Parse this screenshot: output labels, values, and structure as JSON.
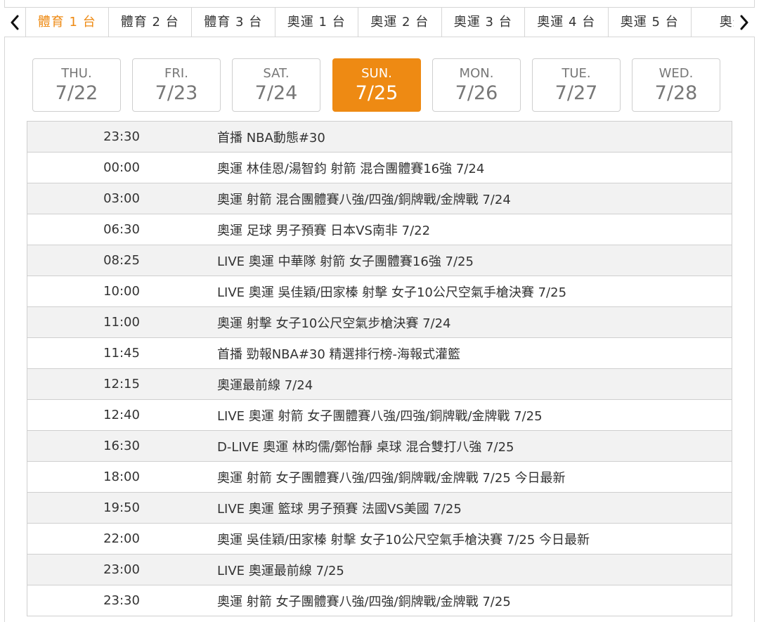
{
  "tabbar": {
    "prev_label": "<",
    "next_label": ">",
    "tabs": [
      {
        "label": "體育 1 台",
        "active": true
      },
      {
        "label": "體育 2 台",
        "active": false
      },
      {
        "label": "體育 3 台",
        "active": false
      },
      {
        "label": "奧運 1 台",
        "active": false
      },
      {
        "label": "奧運 2 台",
        "active": false
      },
      {
        "label": "奧運 3 台",
        "active": false
      },
      {
        "label": "奧運 4 台",
        "active": false
      },
      {
        "label": "奧運 5 台",
        "active": false
      },
      {
        "label": "奧運",
        "active": false
      }
    ]
  },
  "dates": [
    {
      "dow": "THU.",
      "md": "7/22",
      "active": false
    },
    {
      "dow": "FRI.",
      "md": "7/23",
      "active": false
    },
    {
      "dow": "SAT.",
      "md": "7/24",
      "active": false
    },
    {
      "dow": "SUN.",
      "md": "7/25",
      "active": true
    },
    {
      "dow": "MON.",
      "md": "7/26",
      "active": false
    },
    {
      "dow": "TUE.",
      "md": "7/27",
      "active": false
    },
    {
      "dow": "WED.",
      "md": "7/28",
      "active": false
    }
  ],
  "schedule": [
    {
      "time": "23:30",
      "title": "首播 NBA動態#30"
    },
    {
      "time": "00:00",
      "title": "奧運 林佳恩/湯智鈞 射箭 混合團體賽16強 7/24"
    },
    {
      "time": "03:00",
      "title": "奧運 射箭 混合團體賽八強/四強/銅牌戰/金牌戰 7/24"
    },
    {
      "time": "06:30",
      "title": "奧運 足球 男子預賽 日本VS南非 7/22"
    },
    {
      "time": "08:25",
      "title": "LIVE 奧運 中華隊 射箭 女子團體賽16強 7/25"
    },
    {
      "time": "10:00",
      "title": "LIVE 奧運 吳佳穎/田家榛 射擊 女子10公尺空氣手槍決賽 7/25"
    },
    {
      "time": "11:00",
      "title": "奧運 射擊 女子10公尺空氣步槍決賽 7/24"
    },
    {
      "time": "11:45",
      "title": "首播 勁報NBA#30 精選排行榜-海報式灌籃"
    },
    {
      "time": "12:15",
      "title": "奧運最前線 7/24"
    },
    {
      "time": "12:40",
      "title": "LIVE 奧運 射箭 女子團體賽八強/四強/銅牌戰/金牌戰 7/25"
    },
    {
      "time": "16:30",
      "title": "D-LIVE 奧運 林昀儒/鄭怡靜 桌球 混合雙打八強 7/25"
    },
    {
      "time": "18:00",
      "title": "奧運 射箭 女子團體賽八強/四強/銅牌戰/金牌戰 7/25 今日最新"
    },
    {
      "time": "19:50",
      "title": "LIVE 奧運 籃球 男子預賽 法國VS美國 7/25"
    },
    {
      "time": "22:00",
      "title": "奧運 吳佳穎/田家榛 射擊 女子10公尺空氣手槍決賽 7/25 今日最新"
    },
    {
      "time": "23:00",
      "title": "LIVE 奧運最前線 7/25"
    },
    {
      "time": "23:30",
      "title": "奧運 射箭 女子團體賽八強/四強/銅牌戰/金牌戰 7/25"
    }
  ],
  "colors": {
    "accent": "#ee8a13",
    "row_alt": "#f2f2f2",
    "border": "#cfcfcf"
  },
  "icons": {
    "prev": "chevron-left-icon",
    "next": "chevron-right-icon"
  }
}
